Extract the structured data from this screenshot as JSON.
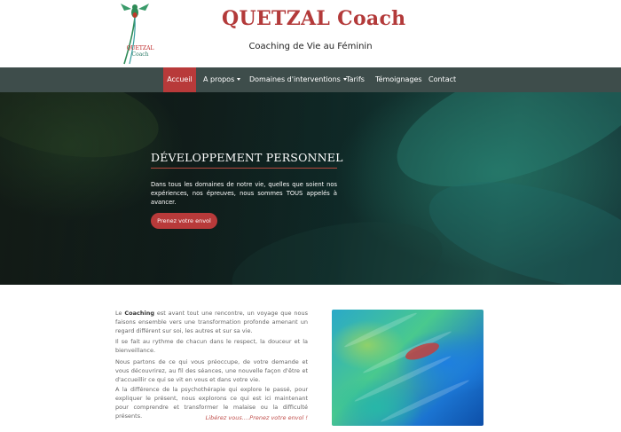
{
  "header": {
    "logo_line1": "QUETZAL",
    "logo_line2": "Coach",
    "site_title": "QUETZAL Coach",
    "tagline": "Coaching de Vie au Féminin"
  },
  "nav": {
    "items": [
      {
        "label": "Accueil",
        "active": true,
        "dropdown": false
      },
      {
        "label": "A propos",
        "active": false,
        "dropdown": true
      },
      {
        "label": "Domaines d'interventions",
        "active": false,
        "dropdown": true
      },
      {
        "label": "Tarifs",
        "active": false,
        "dropdown": false
      },
      {
        "label": "Témoignages",
        "active": false,
        "dropdown": false
      },
      {
        "label": "Contact",
        "active": false,
        "dropdown": false
      }
    ]
  },
  "hero": {
    "title": "DÉVELOPPEMENT PERSONNEL",
    "text": "Dans tous les domaines de notre vie, quelles que soient nos expériences, nos épreuves, nous sommes TOUS appelés à avancer.",
    "button_label": "Prenez votre envol"
  },
  "content": {
    "p1_prefix": "Le ",
    "p1_bold": "Coaching",
    "p1_rest": " est avant tout une rencontre, un voyage que nous faisons ensemble vers une transformation profonde amenant un regard différent sur soi, les autres et sur sa vie.",
    "p2": "Il se fait au rythme de chacun dans le respect, la douceur et la bienveillance.",
    "p3": "Nous partons de ce qui vous préoccupe, de votre demande et vous découvrirez, au fil des séances, une nouvelle façon d'être et d'accueillir ce qui se vit en vous et dans votre vie.",
    "p4": "A la différence de la psychothérapie qui explore le passé, pour expliquer le présent, nous explorons ce qui est ici maintenant pour comprendre et transformer le malaise ou la difficulté présents.",
    "quote": "Libérez vous….Prenez votre envol !"
  },
  "colors": {
    "accent": "#b83a3a",
    "nav_bg": "#3e4d4b",
    "title": "#b33a3a"
  }
}
